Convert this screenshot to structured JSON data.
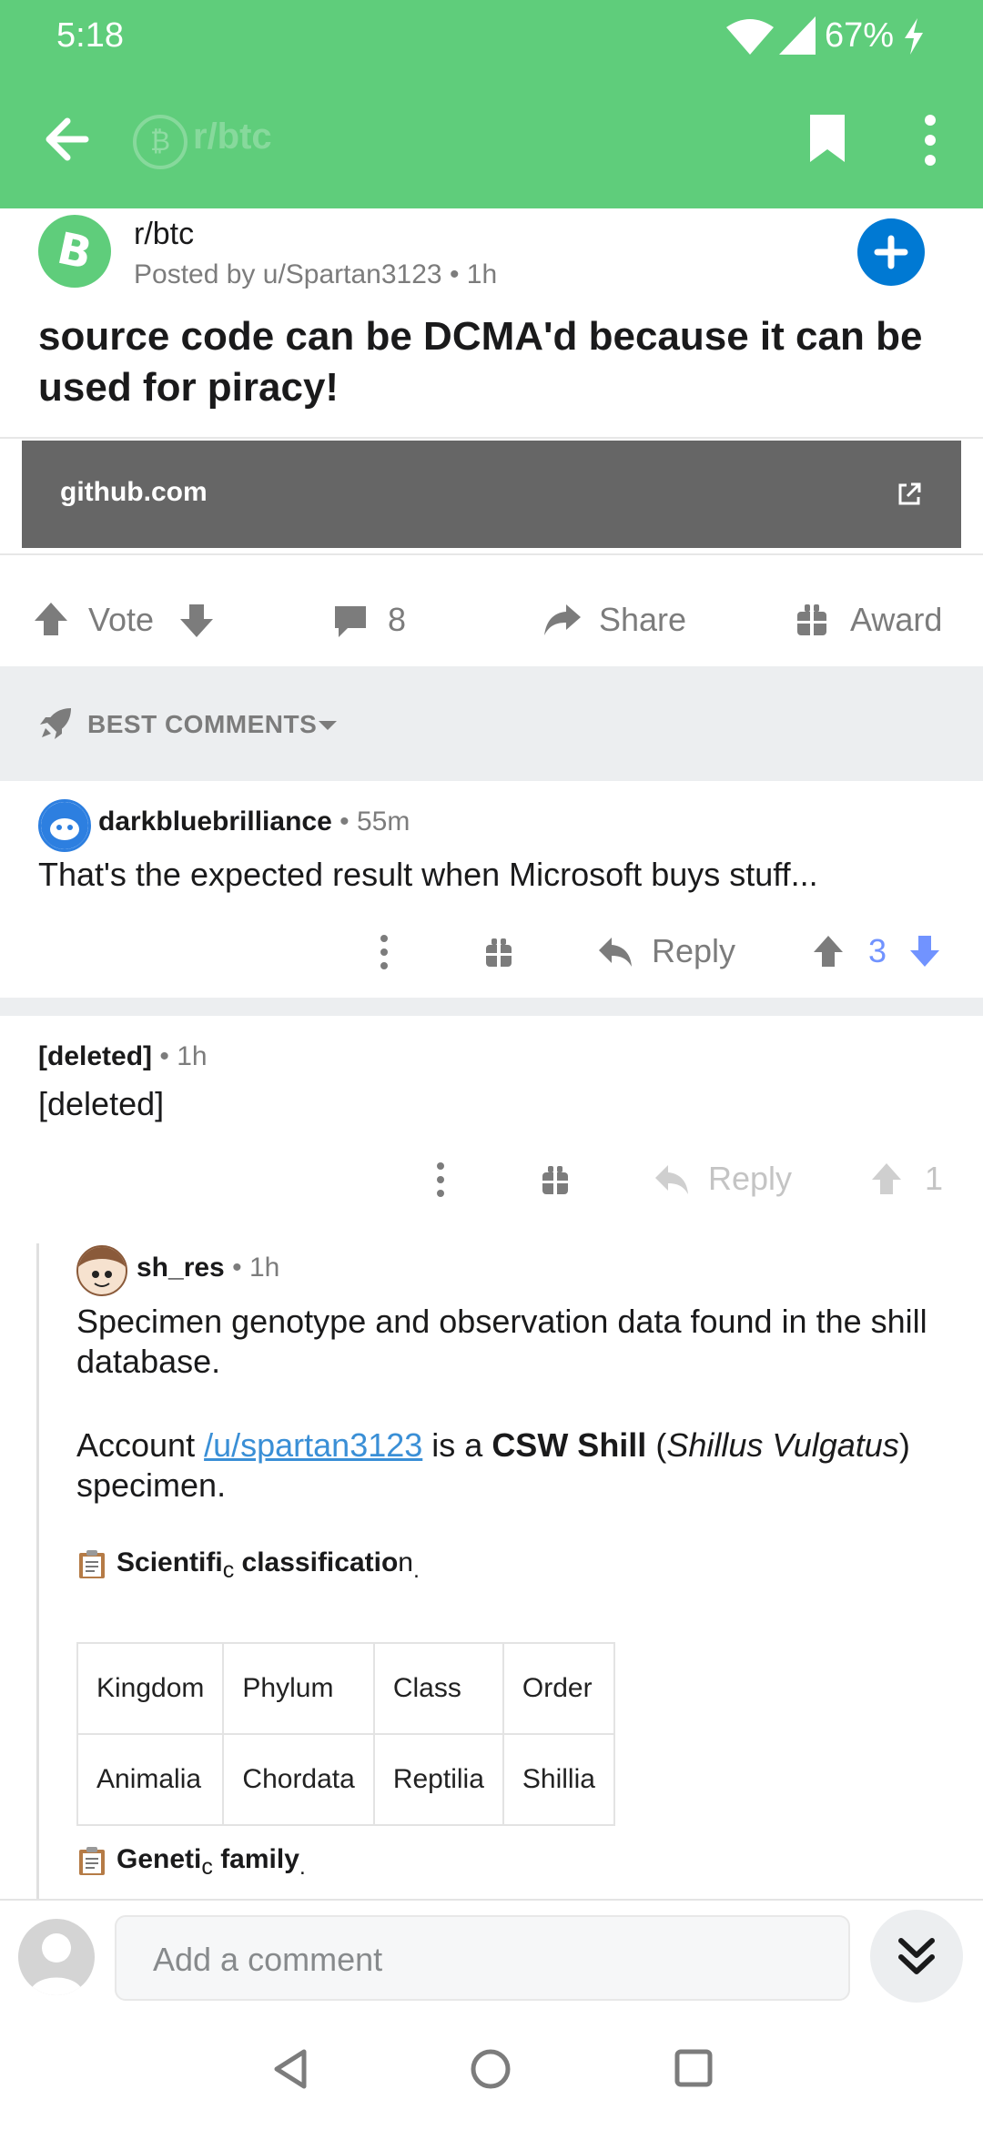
{
  "status": {
    "time": "5:18",
    "battery": "67%"
  },
  "appbar": {
    "title": "r/btc",
    "back_icon": "arrow-left-icon",
    "bookmark_icon": "bookmark-icon",
    "menu_icon": "more-vert-icon"
  },
  "post": {
    "subreddit": "r/btc",
    "posted_by": "Posted by u/Spartan3123",
    "age": "1h",
    "title": "source code can be DCMA'd because it can be used for piracy!",
    "link": {
      "domain": "github.com"
    },
    "actions": {
      "vote": "Vote",
      "comments": "8",
      "share": "Share",
      "award": "Award"
    }
  },
  "sort": {
    "label": "BEST COMMENTS"
  },
  "comments": [
    {
      "author": "darkbluebrilliance",
      "age": "55m",
      "body": "That's the expected result when Microsoft buys stuff...",
      "reply": "Reply",
      "score": "3"
    },
    {
      "author": "[deleted]",
      "age": "1h",
      "body": "[deleted]",
      "reply": "Reply",
      "score": "1"
    }
  ],
  "nested": {
    "author": "sh_res",
    "age": "1h",
    "line1": "Specimen genotype and observation data found in the shill database.",
    "acct_prefix": "Account ",
    "acct_link": "/u/spartan3123",
    "acct_mid": " is a ",
    "acct_bold": "CSW Shill",
    "acct_paren_open": " (",
    "acct_italic": "Shillus Vulgatus",
    "acct_paren_close": ")",
    "acct_suffix": "specimen.",
    "sci_a": "Scientifi",
    "sci_b": "c",
    "sci_c": " classificatio",
    "sci_d": "n",
    "sci_e": ".",
    "table": {
      "headers": [
        "Kingdom",
        "Phylum",
        "Class",
        "Order"
      ],
      "row": [
        "Animalia",
        "Chordata",
        "Reptilia",
        "Shillia"
      ]
    },
    "gen_a": "Geneti",
    "gen_b": "c",
    "gen_c": " family",
    "gen_d": "."
  },
  "composer": {
    "placeholder": "Add a comment"
  },
  "colors": {
    "appbar": "#5fcd7b",
    "upvote": "#7193ff",
    "link": "#3a8fd6",
    "plus": "#0079d3"
  }
}
